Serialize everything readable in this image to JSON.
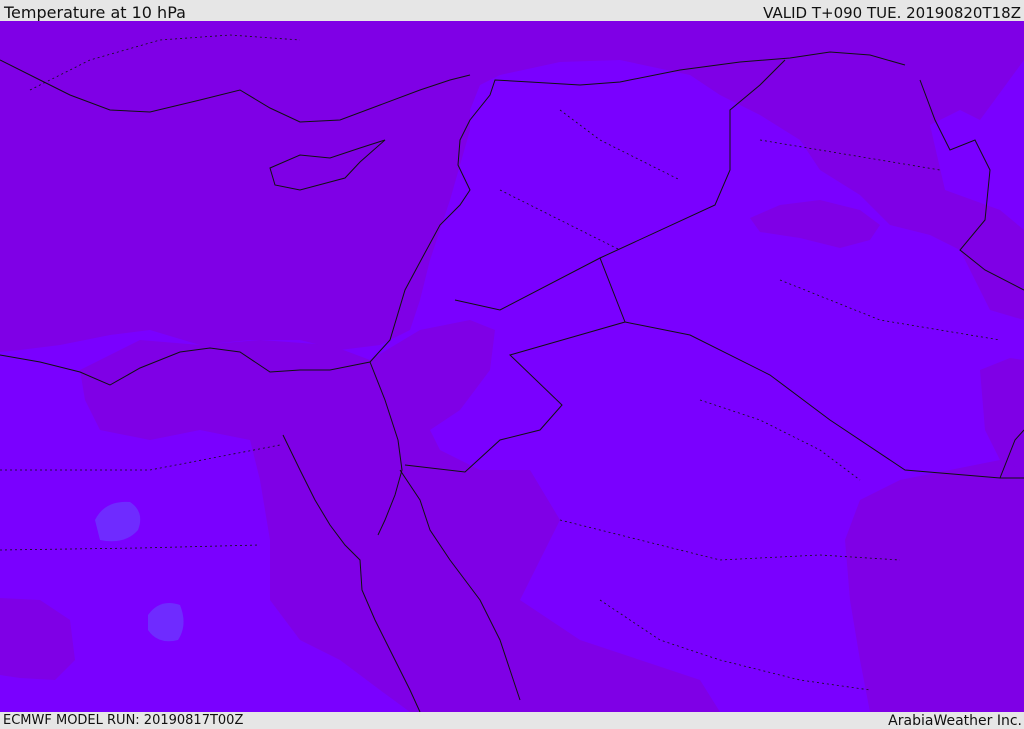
{
  "header": {
    "title": "Temperature at 10 hPa",
    "valid": "VALID T+090 TUE. 20190820T18Z"
  },
  "footer": {
    "model_run": "ECMWF MODEL RUN: 20190817T00Z",
    "credit": "ArabiaWeather Inc."
  },
  "map": {
    "field": "temperature",
    "level": "10 hPa",
    "colors": {
      "warm_band": "#7f00e6",
      "mid_band": "#7a00ff",
      "cool_band": "#6f2bff",
      "borders": "#111111"
    }
  }
}
